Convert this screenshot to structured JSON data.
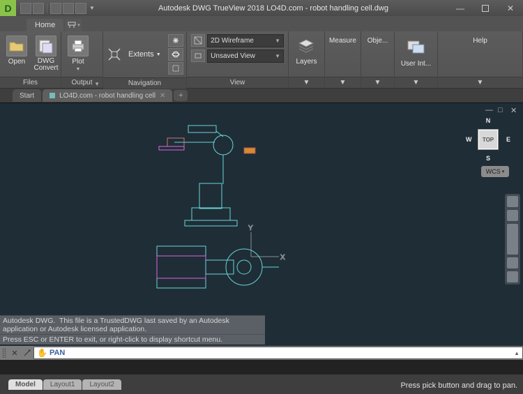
{
  "title": "Autodesk DWG TrueView 2018    LO4D.com - robot handling cell.dwg",
  "ribbon": {
    "tabs": {
      "home": "Home"
    },
    "panels": {
      "files": "Files",
      "output": "Output",
      "navigation": "Navigation",
      "view": "View"
    },
    "open": "Open",
    "dwg_convert": "DWG\nConvert",
    "plot": "Plot",
    "extents": "Extents",
    "visual_style": "2D Wireframe",
    "named_view": "Unsaved View",
    "layers": "Layers",
    "measure": "Measure",
    "object": "Obje...",
    "user_interface": "User Int...",
    "help": "Help"
  },
  "file_tabs": {
    "start": "Start",
    "doc": "LO4D.com - robot handling cell"
  },
  "viewcube": {
    "top": "TOP",
    "n": "N",
    "s": "S",
    "e": "E",
    "w": "W",
    "wcs": "WCS"
  },
  "cmd": {
    "hist1": "Autodesk DWG.  This file is a TrustedDWG last saved by an Autodesk application or Autodesk licensed application.",
    "hist2": "Press ESC or ENTER to exit, or right-click to display shortcut menu.",
    "active": "PAN"
  },
  "layout_tabs": {
    "model": "Model",
    "l1": "Layout1",
    "l2": "Layout2"
  },
  "status": "Press pick button and drag to pan."
}
